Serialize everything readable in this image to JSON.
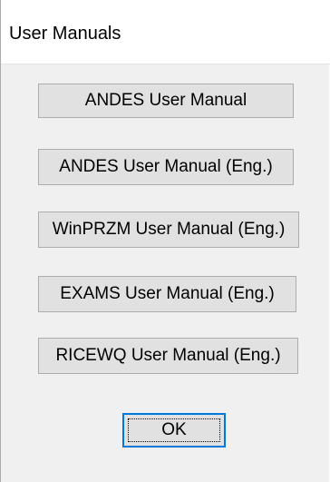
{
  "window": {
    "title": "User Manuals"
  },
  "buttons": [
    {
      "label": "ANDES User Manual"
    },
    {
      "label": "ANDES User Manual (Eng.)"
    },
    {
      "label": "WinPRZM User Manual (Eng.)"
    },
    {
      "label": "EXAMS User Manual (Eng.)"
    },
    {
      "label": "RICEWQ User Manual (Eng.)"
    }
  ],
  "ok_button": {
    "label": "OK"
  },
  "colors": {
    "dialog_background": "#f0f0f0",
    "button_face": "#e1e1e1",
    "button_border": "#adadad",
    "default_button_border": "#0078d7"
  }
}
